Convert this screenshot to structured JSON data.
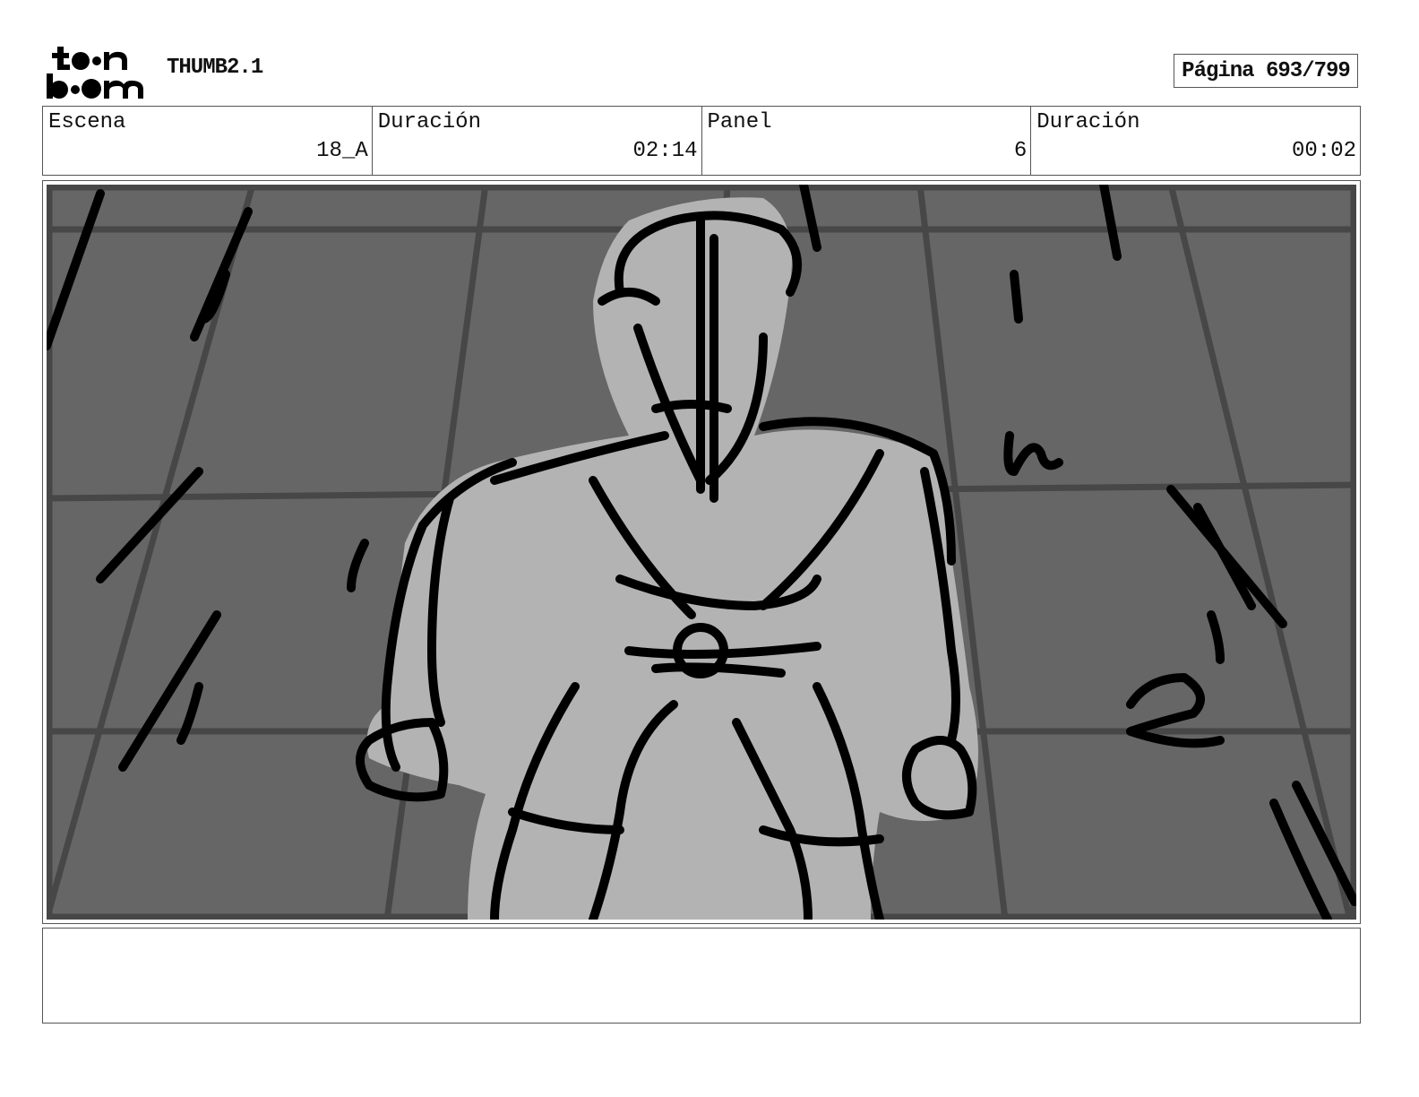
{
  "header": {
    "logo": {
      "line1": "toon",
      "line2": "boom",
      "icon": "toon-boom-logo"
    },
    "title": "THUMB2.1",
    "page_label": "Página 693/799"
  },
  "info": {
    "scene_label": "Escena",
    "scene_value": "18_A",
    "scene_duration_label": "Duración",
    "scene_duration_value": "02:14",
    "panel_label": "Panel",
    "panel_value": "6",
    "panel_duration_label": "Duración",
    "panel_duration_value": "00:02"
  },
  "panel": {
    "image": "storyboard-sketch-character-walking",
    "colors": {
      "background": "#666666",
      "grid": "#474747",
      "figure_fill": "#b3b3b3",
      "ink": "#000000"
    }
  },
  "notes": {
    "text": ""
  }
}
